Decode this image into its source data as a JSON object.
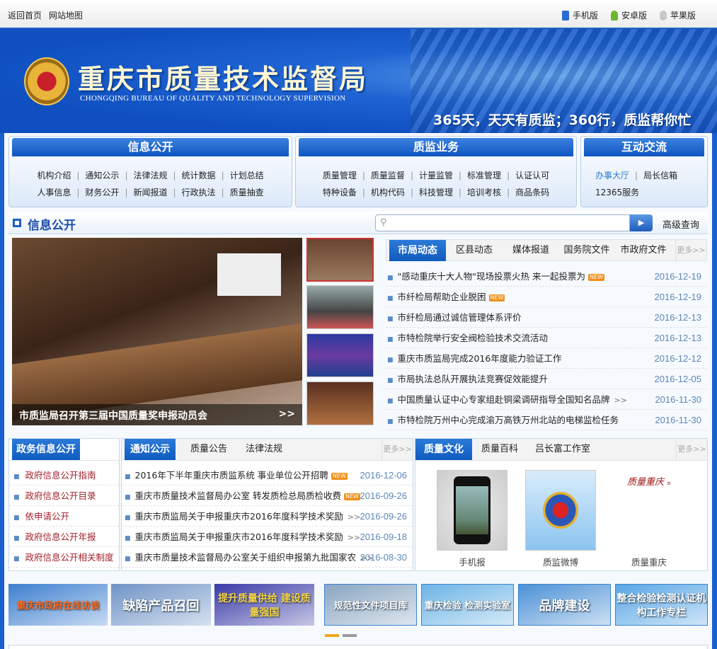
{
  "topbar": {
    "links": [
      "返回首页",
      "网站地图"
    ],
    "apps": [
      {
        "label": "手机版",
        "icon": "mobile-phone-icon",
        "color": "#2a6bd1"
      },
      {
        "label": "安卓版",
        "icon": "android-icon",
        "color": "#6cb52f"
      },
      {
        "label": "苹果版",
        "icon": "apple-icon",
        "color": "#c8c8c8"
      }
    ]
  },
  "banner": {
    "title": "重庆市质量技术监督局",
    "subtitle": "CHONGQING BUREAU OF QUALITY AND TECHNOLOGY SUPERVISION",
    "slogan": "365天，天天有质监；360行，质监帮你忙"
  },
  "nav": [
    {
      "title": "信息公开",
      "rows": [
        [
          "机构介绍",
          "通知公示",
          "法律法规",
          "统计数据",
          "计划总结"
        ],
        [
          "人事信息",
          "财务公开",
          "新闻报道",
          "行政执法",
          "质量抽查"
        ]
      ]
    },
    {
      "title": "质监业务",
      "rows": [
        [
          "质量管理",
          "质量监督",
          "计量监管",
          "标准管理",
          "认证认可"
        ],
        [
          "特种设备",
          "机构代码",
          "科技管理",
          "培训考核",
          "商品条码"
        ]
      ]
    },
    {
      "title": "互动交流",
      "rows": [
        [
          "办事大厅",
          "局长信箱"
        ],
        [
          "12365服务"
        ]
      ]
    }
  ],
  "section": {
    "title": "信息公开",
    "search_placeholder": "",
    "advanced": "高级查询"
  },
  "slide": {
    "caption": "市质监局召开第三届中国质量奖申报动员会",
    "arrow": ">>"
  },
  "news": {
    "tabs": [
      "市局动态",
      "区县动态",
      "媒体报道",
      "国务院文件",
      "市政府文件"
    ],
    "more": "更多>>",
    "new_badge": "NEW",
    "items": [
      {
        "title": "\"感动重庆十大人物\"现场投票火热 来一起投票为",
        "new": true,
        "date": "2016-12-19"
      },
      {
        "title": "市纤检局帮助企业脱困",
        "new": true,
        "date": "2016-12-19"
      },
      {
        "title": "市纤检局通过诚信管理体系评价",
        "date": "2016-12-13"
      },
      {
        "title": "市特检院举行安全阀检验技术交流活动",
        "date": "2016-12-13"
      },
      {
        "title": "重庆市质监局完成2016年度能力验证工作",
        "date": "2016-12-12"
      },
      {
        "title": "市局执法总队开展执法竞赛促效能提升",
        "date": "2016-12-05"
      },
      {
        "title": "中国质量认证中心专家组赴铜梁调研指导全国知名品牌",
        "more": ">>",
        "date": "2016-11-30"
      },
      {
        "title": "市特检院万州中心完成渝万高铁万州北站的电梯监检任务",
        "date": "2016-11-30"
      }
    ]
  },
  "gov": {
    "title": "政务信息公开",
    "items": [
      "政府信息公开指南",
      "政府信息公开目录",
      "依申请公开",
      "政府信息公开年报",
      "政府信息公开相关制度"
    ]
  },
  "notice": {
    "tabs": [
      "通知公示",
      "质量公告",
      "法律法规"
    ],
    "more": "更多>>",
    "items": [
      {
        "title": "2016年下半年重庆市质监系统 事业单位公开招聘",
        "new": true,
        "date": "2016-12-06"
      },
      {
        "title": "重庆市质量技术监督局办公室 转发质检总局质检收费",
        "new": true,
        "date": "2016-09-26"
      },
      {
        "title": "重庆市质监局关于申报重庆市2016年度科学技术奖励",
        "more": ">>",
        "date": "2016-09-26"
      },
      {
        "title": "重庆市质监局关于申报重庆市2016年度科学技术奖励",
        "more": ">>",
        "date": "2016-09-18"
      },
      {
        "title": "重庆市质量技术监督局办公室关于组织申报第九批国家农",
        "more": ">>",
        "date": "2016-08-30"
      }
    ]
  },
  "culture": {
    "tabs": [
      "质量文化",
      "质量百科",
      "吕长富工作室"
    ],
    "more": "更多>>",
    "items": [
      {
        "label": "手机报"
      },
      {
        "label": "质监微博"
      },
      {
        "label": "质量重庆",
        "logo_text": "质量重庆"
      }
    ]
  },
  "banners": [
    {
      "text": "重庆市政府在线访谈",
      "bg": "#3d7fd0",
      "fg": "#ff6a1a"
    },
    {
      "text": "缺陷产品召回",
      "bg": "#6f93c6",
      "fg": "#fff"
    },
    {
      "text": "提升质量供给 建设质量强国",
      "bg": "#3a3aa8",
      "fg": "#f5d44a"
    },
    {
      "text": "规范性文件项目库",
      "bg": "#8aa6c2",
      "fg": "#fff"
    },
    {
      "text": "重庆检验 检测实验室",
      "bg": "#6db4e6",
      "fg": "#fff"
    },
    {
      "text": "品牌建设",
      "bg": "#4c91d6",
      "fg": "#fff"
    },
    {
      "text": "整合检验检测认证机构工作专栏",
      "bg": "#58a6e6",
      "fg": "#fff"
    }
  ],
  "carousel": {
    "pages": 2,
    "active": 1
  }
}
